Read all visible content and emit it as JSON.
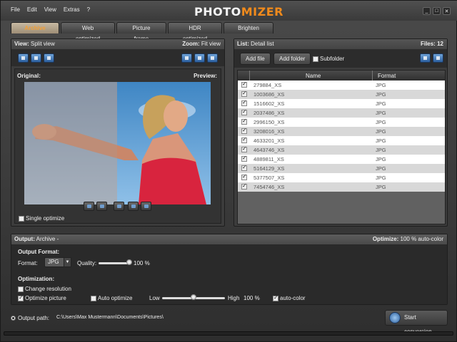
{
  "menu": [
    "File",
    "Edit",
    "View",
    "Extras",
    "?"
  ],
  "logo": {
    "part1": "PHOTO",
    "part2": "MIZER"
  },
  "window_controls": {
    "minimize": "_",
    "maximize": "□",
    "close": "✕"
  },
  "tabs": [
    "Archive",
    "Web optimized",
    "Picture frame",
    "HDR optimized",
    "Brighten"
  ],
  "view_panel": {
    "view_label": "View:",
    "view_value": "Split view",
    "zoom_label": "Zoom:",
    "zoom_value": "Fit view",
    "original_label": "Original:",
    "preview_label": "Preview:",
    "single_optimize_label": "Single optimize"
  },
  "list_panel": {
    "list_label": "List:",
    "list_value": "Detail list",
    "files_label": "Files:",
    "files_count": "12",
    "add_file": "Add file",
    "add_folder": "Add folder",
    "subfolder": "Subfolder",
    "col_name": "Name",
    "col_format": "Format",
    "rows": [
      {
        "name": "279884_XS",
        "format": "JPG"
      },
      {
        "name": "1003686_XS",
        "format": "JPG"
      },
      {
        "name": "1516602_XS",
        "format": "JPG"
      },
      {
        "name": "2037486_XS",
        "format": "JPG"
      },
      {
        "name": "2996150_XS",
        "format": "JPG"
      },
      {
        "name": "3208016_XS",
        "format": "JPG"
      },
      {
        "name": "4633201_XS",
        "format": "JPG"
      },
      {
        "name": "4643746_XS",
        "format": "JPG"
      },
      {
        "name": "4889811_XS",
        "format": "JPG"
      },
      {
        "name": "5164129_XS",
        "format": "JPG"
      },
      {
        "name": "5377507_XS",
        "format": "JPG"
      },
      {
        "name": "7454746_XS",
        "format": "JPG"
      }
    ]
  },
  "output": {
    "output_label": "Output:",
    "output_value": "Archive",
    "output_dash": "-",
    "optimize_label": "Optimize:",
    "optimize_value": "100 % auto-color",
    "format_heading": "Output Format:",
    "format_label": "Format:",
    "format_value": "JPG",
    "quality_label": "Quality:",
    "quality_value": "100",
    "quality_unit": "%",
    "quality_level": 1.0,
    "optimization_heading": "Optimization:",
    "change_resolution": "Change resolution",
    "optimize_picture": "Optimize picture",
    "auto_optimize": "Auto optimize",
    "low_label": "Low",
    "high_label": "High",
    "optimize_amount": "100",
    "optimize_unit": "%",
    "optimize_slider_level": 0.5,
    "auto_color": "auto-color",
    "output_path_label": "Output path:",
    "output_path_value": "C:\\Users\\Max Mustermann\\Documents\\Pictures\\",
    "start_conversion": "Start conversion"
  },
  "colors": {
    "accent": "#f08a1c",
    "tab_active": "#f4a036",
    "button_blue": "#2c5f9e"
  }
}
